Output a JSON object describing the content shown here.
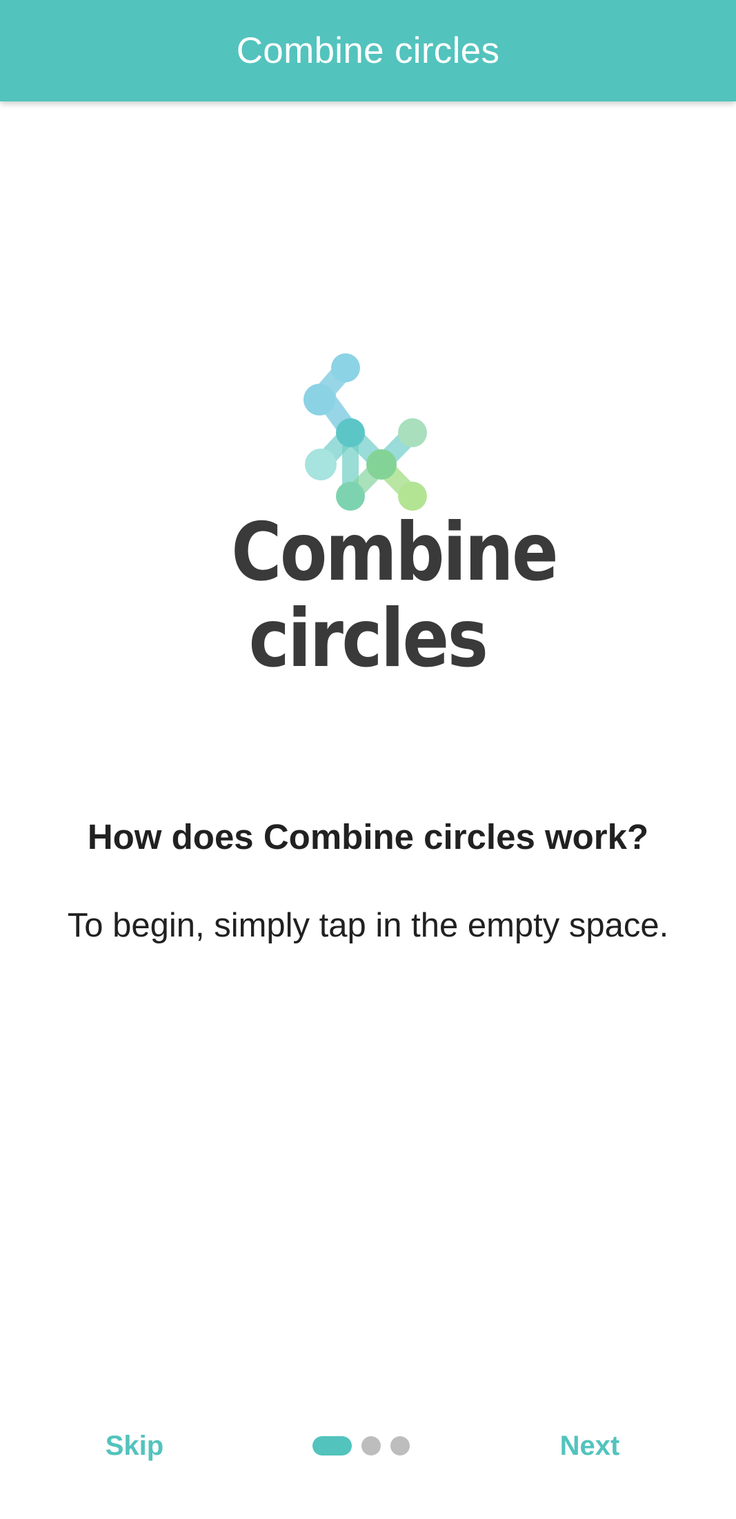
{
  "app_bar": {
    "title": "Combine circles"
  },
  "logo": {
    "line1": "Combine",
    "line2": "circles",
    "icon": "molecule-circles-logo"
  },
  "onboarding": {
    "heading": "How does Combine circles work?",
    "body": "To begin, simply tap in the empty space."
  },
  "nav": {
    "skip_label": "Skip",
    "next_label": "Next",
    "page_count": 3,
    "current_page": 1
  },
  "colors": {
    "accent": "#53c3bd",
    "dot_inactive": "#bdbdbd",
    "text": "#212121"
  }
}
